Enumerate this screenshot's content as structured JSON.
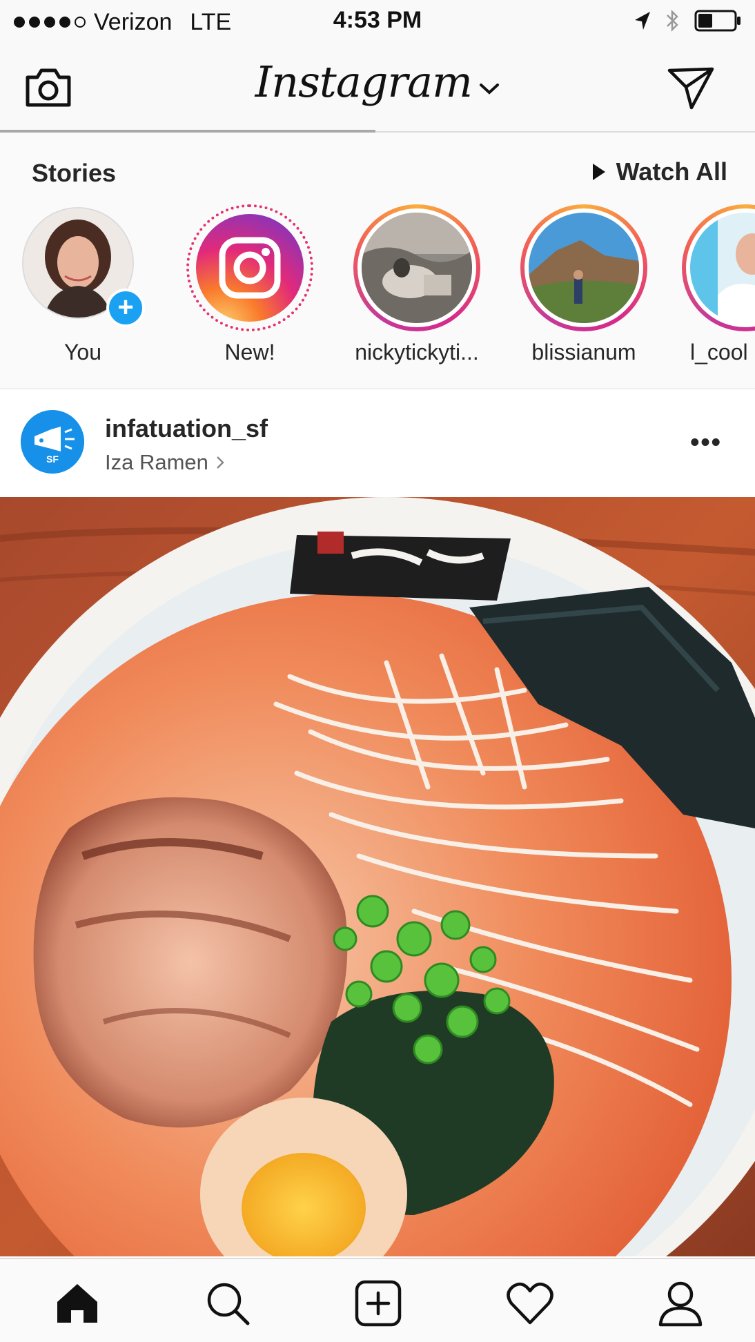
{
  "status_bar": {
    "carrier": "Verizon",
    "network": "LTE",
    "time": "4:53 PM",
    "signal_bars": 4,
    "signal_max": 5,
    "battery_level": 0.4
  },
  "header": {
    "logo": "Instagram",
    "camera_icon": "camera-icon",
    "direct_icon": "paper-plane-icon",
    "dropdown_icon": "chevron-down-icon"
  },
  "stories": {
    "title": "Stories",
    "watch_all": "Watch All",
    "items": [
      {
        "label": "You",
        "ring": "none",
        "badge": "+"
      },
      {
        "label": "New!",
        "ring": "dotted"
      },
      {
        "label": "nickytickyti...",
        "ring": "gradient"
      },
      {
        "label": "blissianum",
        "ring": "gradient"
      },
      {
        "label": "l_cool",
        "ring": "gradient"
      }
    ]
  },
  "post": {
    "username": "infatuation_sf",
    "location": "Iza Ramen",
    "avatar_text": "SF",
    "more": "•••"
  },
  "tabbar": {
    "items": [
      "home-icon",
      "search-icon",
      "add-post-icon",
      "heart-icon",
      "profile-icon"
    ],
    "active": "home-icon"
  },
  "colors": {
    "accent_blue": "#1aa1f2",
    "story_ring_gradient": [
      "#f9ae3c",
      "#d62a8a"
    ],
    "text": "#262626"
  }
}
